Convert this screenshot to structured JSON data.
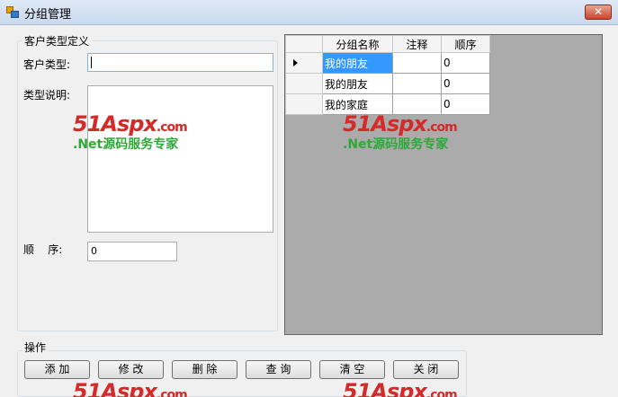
{
  "window": {
    "title": "分组管理",
    "close_glyph": "✕"
  },
  "group_define": {
    "title": "客户类型定义",
    "type_label": "客户类型:",
    "type_value": "",
    "desc_label": "类型说明:",
    "desc_value": "",
    "order_label": "顺    序:",
    "order_value": "0"
  },
  "grid": {
    "columns": [
      "分组名称",
      "注释",
      "顺序"
    ],
    "rows": [
      {
        "name": "我的朋友",
        "note": "",
        "order": "0",
        "selected": true
      },
      {
        "name": "我的朋友",
        "note": "",
        "order": "0",
        "selected": false
      },
      {
        "name": "我的家庭",
        "note": "",
        "order": "0",
        "selected": false
      }
    ]
  },
  "operations": {
    "title": "操作",
    "buttons": [
      "添 加",
      "修 改",
      "删 除",
      "查 询",
      "清 空",
      "关 闭"
    ]
  },
  "watermark": {
    "logo": "51Aspx",
    "logo_suffix": ".com",
    "subtitle": ".Net源码服务专家"
  }
}
